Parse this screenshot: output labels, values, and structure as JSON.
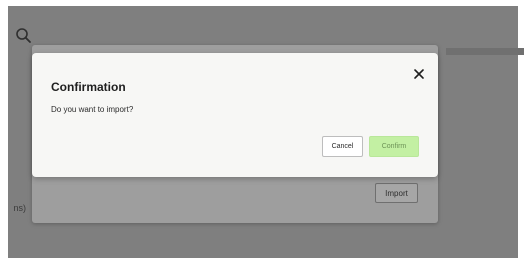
{
  "dialog": {
    "title": "Confirmation",
    "message": "Do you want to import?",
    "cancel_label": "Cancel",
    "confirm_label": "Confirm",
    "close_icon": "close-icon"
  },
  "background": {
    "left_text": "ns)",
    "import_label": "Import",
    "search_icon": "search-icon"
  },
  "colors": {
    "overlay": "#7f7f7f",
    "dialog_bg": "#f7f7f5",
    "confirm_bg": "#c3f0a3",
    "confirm_text": "#6d9357"
  }
}
